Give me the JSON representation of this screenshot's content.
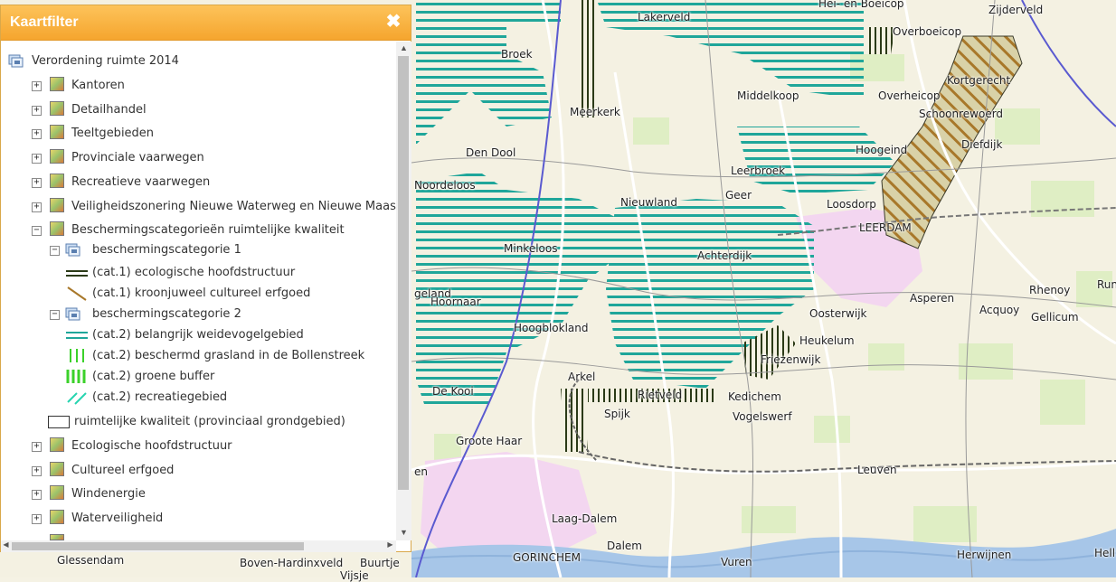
{
  "panel": {
    "title": "Kaartfilter",
    "close_symbol": "✖",
    "root_label": "Verordening ruimte 2014",
    "layers": [
      {
        "label": "Kantoren",
        "expander": "+"
      },
      {
        "label": "Detailhandel",
        "expander": "+"
      },
      {
        "label": "Teeltgebieden",
        "expander": "+"
      },
      {
        "label": "Provinciale vaarwegen",
        "expander": "+"
      },
      {
        "label": "Recreatieve vaarwegen",
        "expander": "+"
      },
      {
        "label": "Veiligheidszonering Nieuwe Waterweg en Nieuwe Maas",
        "expander": "+"
      },
      {
        "label": "Beschermingscategorieën ruimtelijke kwaliteit",
        "expander": "−"
      }
    ],
    "cat1": {
      "label": "beschermingscategorie 1",
      "expander": "−",
      "items": [
        "(cat.1) ecologische hoofdstructuur",
        "(cat.1) kroonjuweel cultureel erfgoed"
      ]
    },
    "cat2": {
      "label": "beschermingscategorie 2",
      "expander": "−",
      "items": [
        "(cat.2) belangrijk weidevogelgebied",
        "(cat.2) beschermd grasland in de Bollenstreek",
        "(cat.2) groene buffer",
        "(cat.2) recreatiegebied"
      ]
    },
    "rk_label": "ruimtelijke kwaliteit (provinciaal grondgebied)",
    "layers_after": [
      {
        "label": "Ecologische hoofdstructuur",
        "expander": "+"
      },
      {
        "label": "Cultureel erfgoed",
        "expander": "+"
      },
      {
        "label": "Windenergie",
        "expander": "+"
      },
      {
        "label": "Waterveiligheid",
        "expander": "+"
      }
    ]
  },
  "map_labels": [
    "Lakerveld",
    "Hei- en Boeicop",
    "Zijderveld",
    "Overboeicop",
    "Broek",
    "Kortgerecht",
    "Middelkoop",
    "Overheicop",
    "Meerkerk",
    "Schoonrewoerd",
    "Diefdijk",
    "Den Dool",
    "Hoogeind",
    "Leerbroek",
    "Noordeloos",
    "Geer",
    "Nieuwland",
    "Loosdorp",
    "LEERDAM",
    "Minkeloos",
    "Achterdijk",
    "geland",
    "Hoornaar",
    "Asperen",
    "Rhenoy",
    "Run",
    "Acquoy",
    "Oosterwijk",
    "Gellicum",
    "Hoogblokland",
    "Heukelum",
    "Friezenwijk",
    "Arkel",
    "De Kooi",
    "Rietveld",
    "Kedichem",
    "Spijk",
    "Vogelswerf",
    "Groote Haar",
    "en",
    "Leuven",
    "Laag-Dalem",
    "GORINCHEM",
    "Dalem",
    "Glessendam",
    "Boven-Hardinxveld",
    "Buurtje",
    "Vuren",
    "Herwijnen",
    "Hell",
    "Vijsje"
  ],
  "colors": {
    "header_orange": "#f5a52e",
    "weidevogel_hatch": "#1fa69a",
    "ehs_line": "#2b3a17",
    "kroonjuweel": "#a8782a",
    "urban": "#f3d6f0",
    "river": "#a7c6e8"
  }
}
